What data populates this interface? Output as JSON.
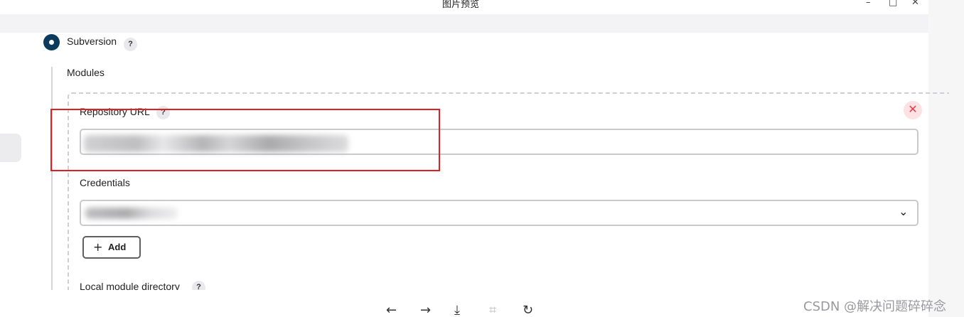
{
  "viewer": {
    "title": "图片预览",
    "minimize_glyph": "–",
    "maximize_glyph": "□",
    "close_glyph": "✕"
  },
  "scm": {
    "radio_label": "Subversion",
    "modules_label": "Modules"
  },
  "help_glyph": "?",
  "module": {
    "repository_url_label": "Repository URL",
    "repository_url_value": "",
    "credentials_label": "Credentials",
    "credentials_value": "",
    "add_label": "Add",
    "add_icon": "+",
    "delete_glyph": "✕",
    "dropdown_glyph": "⌄",
    "local_module_label": "Local module directory"
  },
  "toolbar": {
    "prev_glyph": "←",
    "next_glyph": "→",
    "download_glyph": "⤓",
    "fit_glyph": "⌗",
    "rotate_glyph": "↻"
  },
  "watermark": "CSDN @解决问题碎碎念",
  "colors": {
    "radio_accent": "#0b3a5c",
    "highlight_box": "#e02020",
    "delete_icon": "#e23c4a"
  },
  "icons": {
    "radio": "radio-selected-icon",
    "help": "help-icon",
    "delete": "close-icon",
    "dropdown": "chevron-down-icon",
    "add": "plus-icon",
    "prev": "arrow-left-icon",
    "next": "arrow-right-icon",
    "download": "download-icon",
    "fit": "fit-screen-icon",
    "rotate": "rotate-icon"
  }
}
